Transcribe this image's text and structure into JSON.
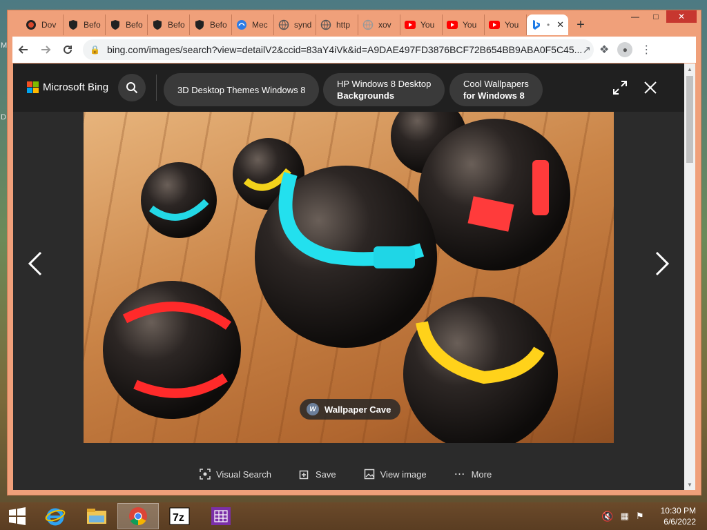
{
  "browser": {
    "tabs": [
      {
        "label": "Dov",
        "icon": "firefox-icon",
        "color": "#d9472a"
      },
      {
        "label": "Befo",
        "icon": "shield-icon",
        "color": "#222222"
      },
      {
        "label": "Befo",
        "icon": "shield-icon",
        "color": "#222222"
      },
      {
        "label": "Befo",
        "icon": "shield-icon",
        "color": "#222222"
      },
      {
        "label": "Befo",
        "icon": "shield-icon",
        "color": "#222222"
      },
      {
        "label": "Mec",
        "icon": "meta-icon",
        "color": "#2c7be5"
      },
      {
        "label": "synd",
        "icon": "globe-icon",
        "color": "#555555"
      },
      {
        "label": "http",
        "icon": "globe-icon",
        "color": "#555555"
      },
      {
        "label": "xov",
        "icon": "globe-icon",
        "color": "#999999"
      },
      {
        "label": "You",
        "icon": "youtube-icon",
        "color": "#ff0000"
      },
      {
        "label": "You",
        "icon": "youtube-icon",
        "color": "#ff0000"
      },
      {
        "label": "You",
        "icon": "youtube-icon",
        "color": "#ff0000"
      }
    ],
    "active_tab": {
      "label": "•",
      "icon": "bing-icon",
      "close": "✕"
    },
    "new_tab": "+",
    "url": "bing.com/images/search?view=detailV2&ccid=83aY4iVk&id=A9DAE497FD3876BCF72B654BB9ABA0F5C45..."
  },
  "bing": {
    "brand": "Microsoft Bing",
    "pills": [
      {
        "line1": "3D Desktop Themes Windows 8",
        "line2": ""
      },
      {
        "line1": "HP Windows 8 Desktop",
        "line2": "Backgrounds"
      },
      {
        "line1": "Cool Wallpapers",
        "line2": "for Windows 8"
      }
    ],
    "source": "Wallpaper Cave",
    "actions": {
      "visual_search": "Visual Search",
      "save": "Save",
      "view_image": "View image",
      "more": "More"
    }
  },
  "taskbar": {
    "time": "10:30 PM",
    "date": "6/6/2022"
  },
  "desktop": {
    "letters": [
      "M",
      "D"
    ]
  }
}
